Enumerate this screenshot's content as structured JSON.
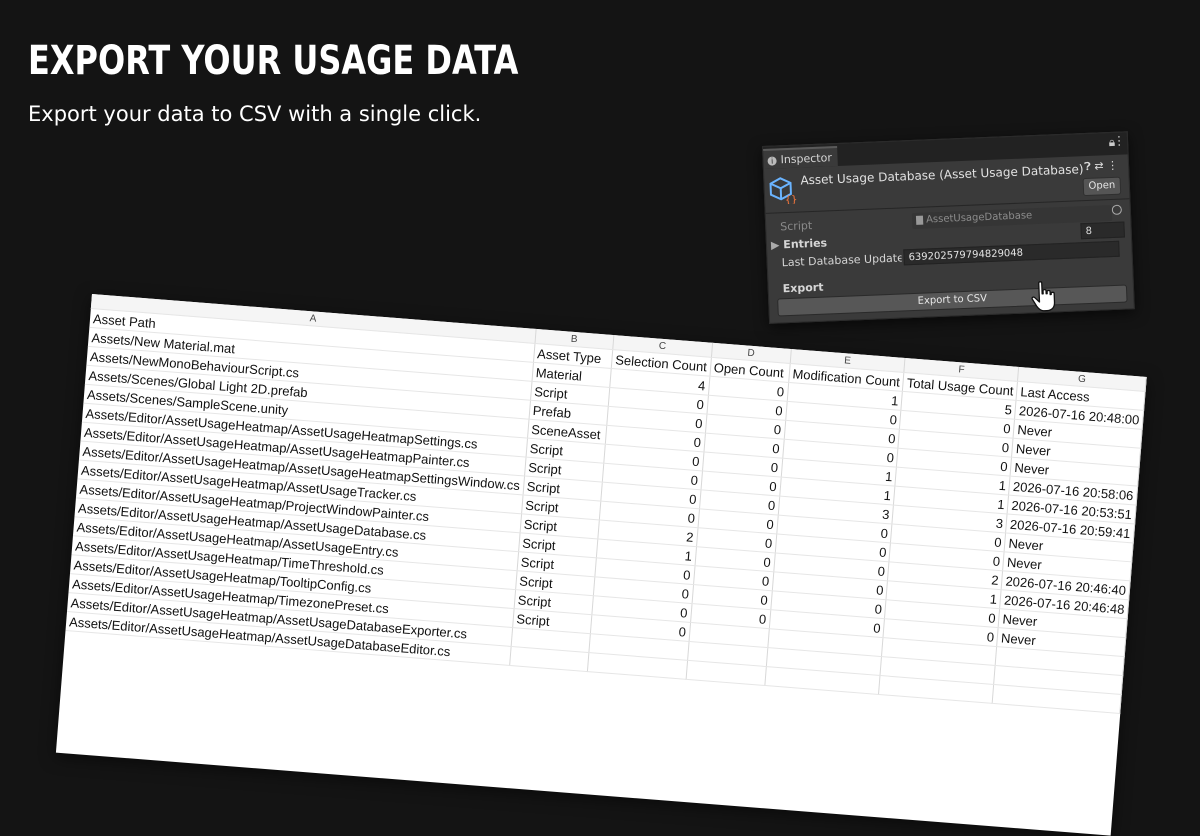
{
  "hero": {
    "title": "EXPORT YOUR USAGE DATA",
    "subtitle": "Export your data to CSV with a single click."
  },
  "inspector": {
    "tab_label": "Inspector",
    "component_title": "Asset Usage Database (Asset Usage Database)",
    "open_label": "Open",
    "script_label": "Script",
    "script_value": "AssetUsageDatabase",
    "entries_label": "Entries",
    "entries_count": "8",
    "tick_label": "Last Database Update Tick",
    "tick_value": "639202579794829048",
    "export_section_label": "Export",
    "export_button_label": "Export to CSV"
  },
  "sheet": {
    "column_letters": [
      "A",
      "B",
      "C",
      "D",
      "E",
      "F",
      "G"
    ],
    "headers": [
      "Asset Path",
      "Asset Type",
      "Selection Count",
      "Open Count",
      "Modification Count",
      "Total Usage Count",
      "Last Access"
    ],
    "rows": [
      [
        "Assets/New Material.mat",
        "Material",
        "4",
        "0",
        "1",
        "5",
        "2026-07-16 20:48:00"
      ],
      [
        "Assets/NewMonoBehaviourScript.cs",
        "Script",
        "0",
        "0",
        "0",
        "0",
        "Never"
      ],
      [
        "Assets/Scenes/Global Light 2D.prefab",
        "Prefab",
        "0",
        "0",
        "0",
        "0",
        "Never"
      ],
      [
        "Assets/Scenes/SampleScene.unity",
        "SceneAsset",
        "0",
        "0",
        "0",
        "0",
        "Never"
      ],
      [
        "Assets/Editor/AssetUsageHeatmap/AssetUsageHeatmapSettings.cs",
        "Script",
        "0",
        "0",
        "1",
        "1",
        "2026-07-16 20:58:06"
      ],
      [
        "Assets/Editor/AssetUsageHeatmap/AssetUsageHeatmapPainter.cs",
        "Script",
        "0",
        "0",
        "1",
        "1",
        "2026-07-16 20:53:51"
      ],
      [
        "Assets/Editor/AssetUsageHeatmap/AssetUsageHeatmapSettingsWindow.cs",
        "Script",
        "0",
        "0",
        "3",
        "3",
        "2026-07-16 20:59:41"
      ],
      [
        "Assets/Editor/AssetUsageHeatmap/AssetUsageTracker.cs",
        "Script",
        "0",
        "0",
        "0",
        "0",
        "Never"
      ],
      [
        "Assets/Editor/AssetUsageHeatmap/ProjectWindowPainter.cs",
        "Script",
        "2",
        "0",
        "0",
        "0",
        "Never"
      ],
      [
        "Assets/Editor/AssetUsageHeatmap/AssetUsageDatabase.cs",
        "Script",
        "1",
        "0",
        "0",
        "2",
        "2026-07-16 20:46:40"
      ],
      [
        "Assets/Editor/AssetUsageHeatmap/AssetUsageEntry.cs",
        "Script",
        "0",
        "0",
        "0",
        "1",
        "2026-07-16 20:46:48"
      ],
      [
        "Assets/Editor/AssetUsageHeatmap/TimeThreshold.cs",
        "Script",
        "0",
        "0",
        "0",
        "0",
        "Never"
      ],
      [
        "Assets/Editor/AssetUsageHeatmap/TooltipConfig.cs",
        "Script",
        "0",
        "0",
        "0",
        "0",
        "Never"
      ],
      [
        "Assets/Editor/AssetUsageHeatmap/TimezonePreset.cs",
        "Script",
        "0",
        "",
        "",
        "",
        ""
      ],
      [
        "Assets/Editor/AssetUsageHeatmap/AssetUsageDatabaseExporter.cs",
        "",
        "",
        "",
        "",
        "",
        ""
      ],
      [
        "Assets/Editor/AssetUsageHeatmap/AssetUsageDatabaseEditor.cs",
        "",
        "",
        "",
        "",
        "",
        ""
      ]
    ]
  }
}
